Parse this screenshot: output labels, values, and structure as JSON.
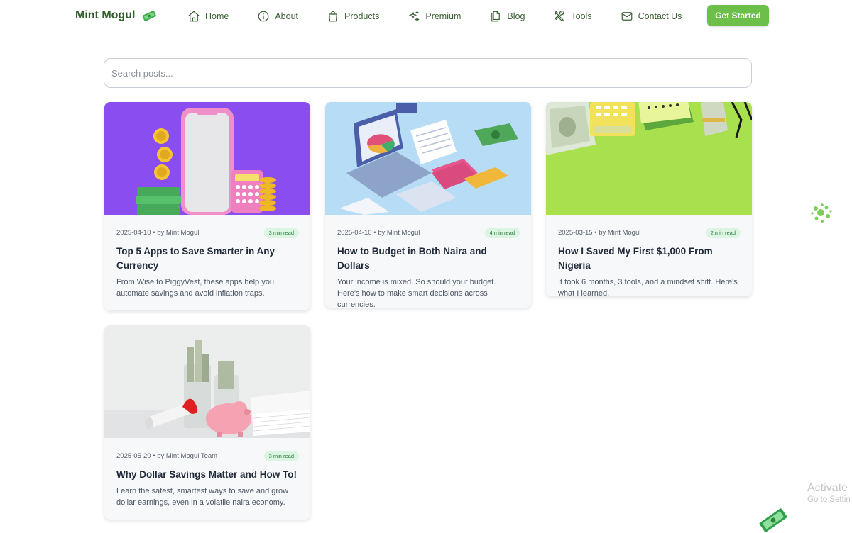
{
  "brand": {
    "name": "Mint Mogul",
    "logo_icon": "money-bill-icon"
  },
  "nav": {
    "items": [
      {
        "label": "Home",
        "icon": "home-icon"
      },
      {
        "label": "About",
        "icon": "info-icon"
      },
      {
        "label": "Products",
        "icon": "shopping-bag-icon"
      },
      {
        "label": "Premium",
        "icon": "sparkles-icon"
      },
      {
        "label": "Blog",
        "icon": "documents-icon"
      },
      {
        "label": "Tools",
        "icon": "tools-icon"
      },
      {
        "label": "Contact Us",
        "icon": "mail-icon"
      }
    ],
    "cta": "Get Started"
  },
  "search": {
    "placeholder": "Search posts...",
    "value": ""
  },
  "posts": [
    {
      "date": "2025-04-10",
      "author": "by Mint Mogul",
      "read_time": "3 min read",
      "title": "Top 5 Apps to Save Smarter in Any Currency",
      "excerpt": "From Wise to PiggyVest, these apps help you automate savings and avoid inflation traps.",
      "image": "phone-tax-calculator-illustration"
    },
    {
      "date": "2025-04-10",
      "author": "by Mint Mogul",
      "read_time": "4 min read",
      "title": "How to Budget in Both Naira and Dollars",
      "excerpt": "Your income is mixed. So should your budget. Here's how to make smart decisions across currencies.",
      "image": "isometric-budget-laptop-illustration"
    },
    {
      "date": "2025-03-15",
      "author": "by Mint Mogul",
      "read_time": "2 min read",
      "title": "How I Saved My First $1,000 From Nigeria",
      "excerpt": "It took 6 months, 3 tools, and a mindset shift. Here's what I learned.",
      "image": "cash-calculator-green-desk-photo"
    },
    {
      "date": "2025-05-20",
      "author": "by Mint Mogul Team",
      "read_time": "3 min read",
      "title": "Why Dollar Savings Matter and How To!",
      "excerpt": "Learn the safest, smartest ways to save and grow dollar earnings, even in a volatile naira economy.",
      "image": "piggy-bank-money-jars-photo"
    }
  ],
  "watermark": {
    "line1": "Activate",
    "line2": "Go to Settin"
  },
  "colors": {
    "accent": "#6cc04a",
    "brand_text": "#2f5d2a",
    "badge_bg": "#dcf5e2",
    "badge_text": "#2d7a40"
  }
}
